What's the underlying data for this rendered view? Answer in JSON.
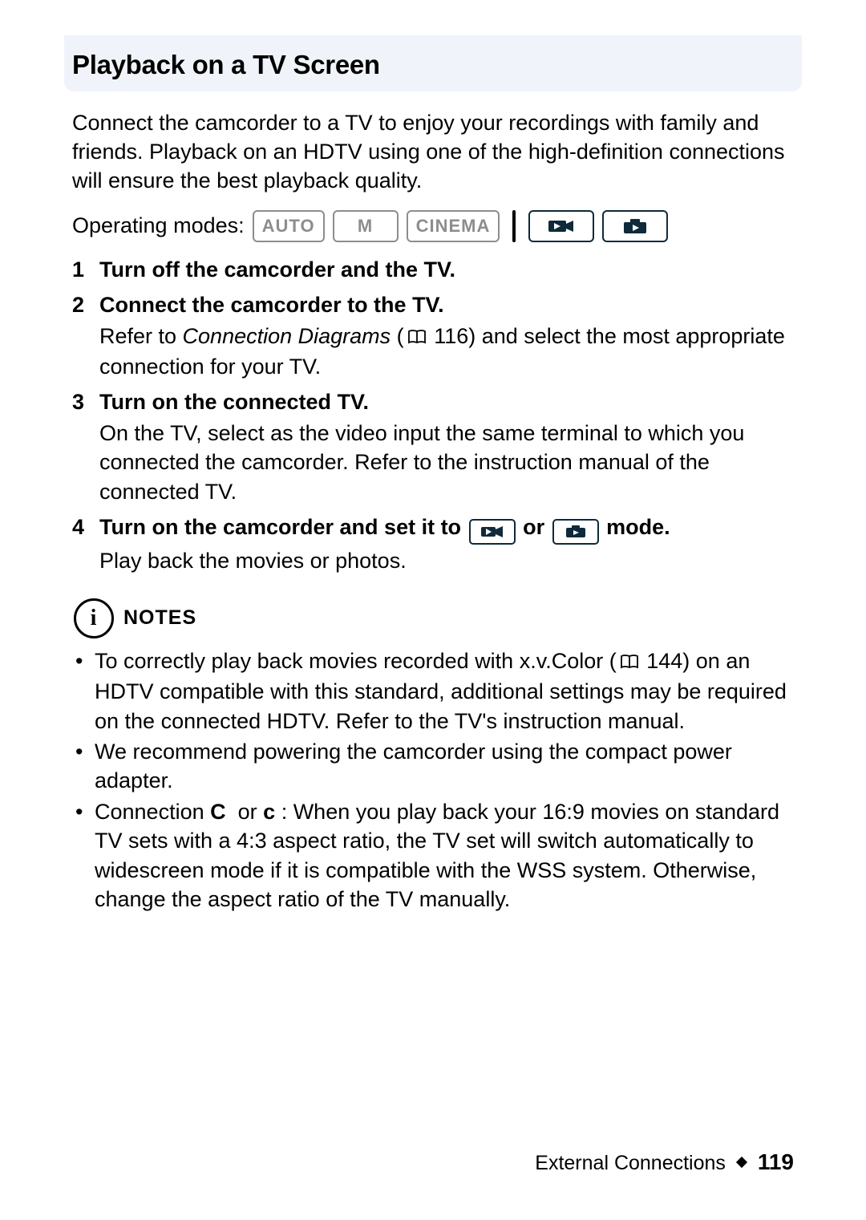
{
  "header": {
    "title": "Playback on a TV Screen"
  },
  "intro": "Connect the camcorder to a TV to enjoy your recordings with family and friends. Playback on an HDTV using one of the high-definition connections will ensure the best playback quality.",
  "modes": {
    "label": "Operating modes:",
    "items": [
      "AUTO",
      "M",
      "CINEMA"
    ],
    "playback_items": [
      "movie-play-mode",
      "photo-play-mode"
    ]
  },
  "steps": [
    {
      "head": "Turn off the camcorder and the TV."
    },
    {
      "head": "Connect the camcorder to the TV.",
      "body_prefix": "Refer to ",
      "ref_label": "Connection Diagrams",
      "ref_page": "116",
      "body_suffix": ") and select the most appropriate connection for your TV."
    },
    {
      "head": "Turn on the connected TV.",
      "body": "On the TV, select as the video input the same terminal to which you connected the camcorder. Refer to the instruction manual of the connected TV."
    },
    {
      "head_prefix": "Turn on the camcorder and set it to ",
      "head_middle": " or ",
      "head_suffix": " mode.",
      "body": "Play back the movies or photos."
    }
  ],
  "notes_label": "NOTES",
  "notes": [
    {
      "prefix": "To correctly play back movies recorded with x.v.Color (",
      "ref_page": "144",
      "suffix": ") on an HDTV compatible with this standard, additional settings may be required on the connected HDTV. Refer to the TV's instruction manual."
    },
    {
      "text": "We recommend powering the camcorder using the compact power adapter."
    },
    {
      "prefix": "Connection ",
      "c1": "C",
      "mid": " or ",
      "c2": "c",
      "suffix": ": When you play back your 16:9 movies on standard TV sets with a 4:3 aspect ratio, the TV set will switch automatically to widescreen mode if it is compatible with the WSS system. Otherwise, change the aspect ratio of the TV manually."
    }
  ],
  "footer": {
    "section": "External Connections",
    "page": "119"
  },
  "info_char": "i"
}
